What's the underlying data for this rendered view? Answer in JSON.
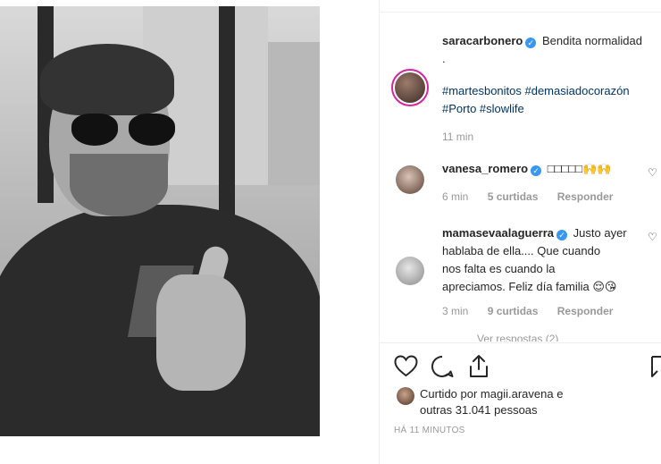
{
  "post": {
    "author": "saracarbonero",
    "caption_line1": "Bendita normalidad",
    "caption_line2": ".",
    "hashtags_line1": "#martesbonitos #demasiadocorazón",
    "hashtags_line2": "#Porto #slowlife",
    "time": "11 min"
  },
  "comments": [
    {
      "user": "vanesa_romero",
      "text": "□□□□□🙌🙌",
      "time": "6 min",
      "likes": "5 curtidas",
      "reply": "Responder"
    },
    {
      "user": "mamasevaalaguerra",
      "text_line1": "Justo ayer",
      "text_line2": "hablaba de ella.... Que cuando",
      "text_line3": "nos falta es cuando la",
      "text_line4": "apreciamos. Feliz día familia 😌😘",
      "time": "3 min",
      "likes": "9 curtidas",
      "reply": "Responder"
    }
  ],
  "more_replies": "Ver respostas (2)",
  "liked_by": {
    "line1": "Curtido por magii.aravena e",
    "line2": "outras 31.041 pessoas"
  },
  "timestamp": "HÁ 11 MINUTOS",
  "icons": {
    "like": "heart-icon",
    "comment": "comment-icon",
    "share": "share-icon",
    "save": "bookmark-icon"
  },
  "colors": {
    "hashtag": "#003569",
    "verified": "#3897f0",
    "meta": "#999999"
  }
}
